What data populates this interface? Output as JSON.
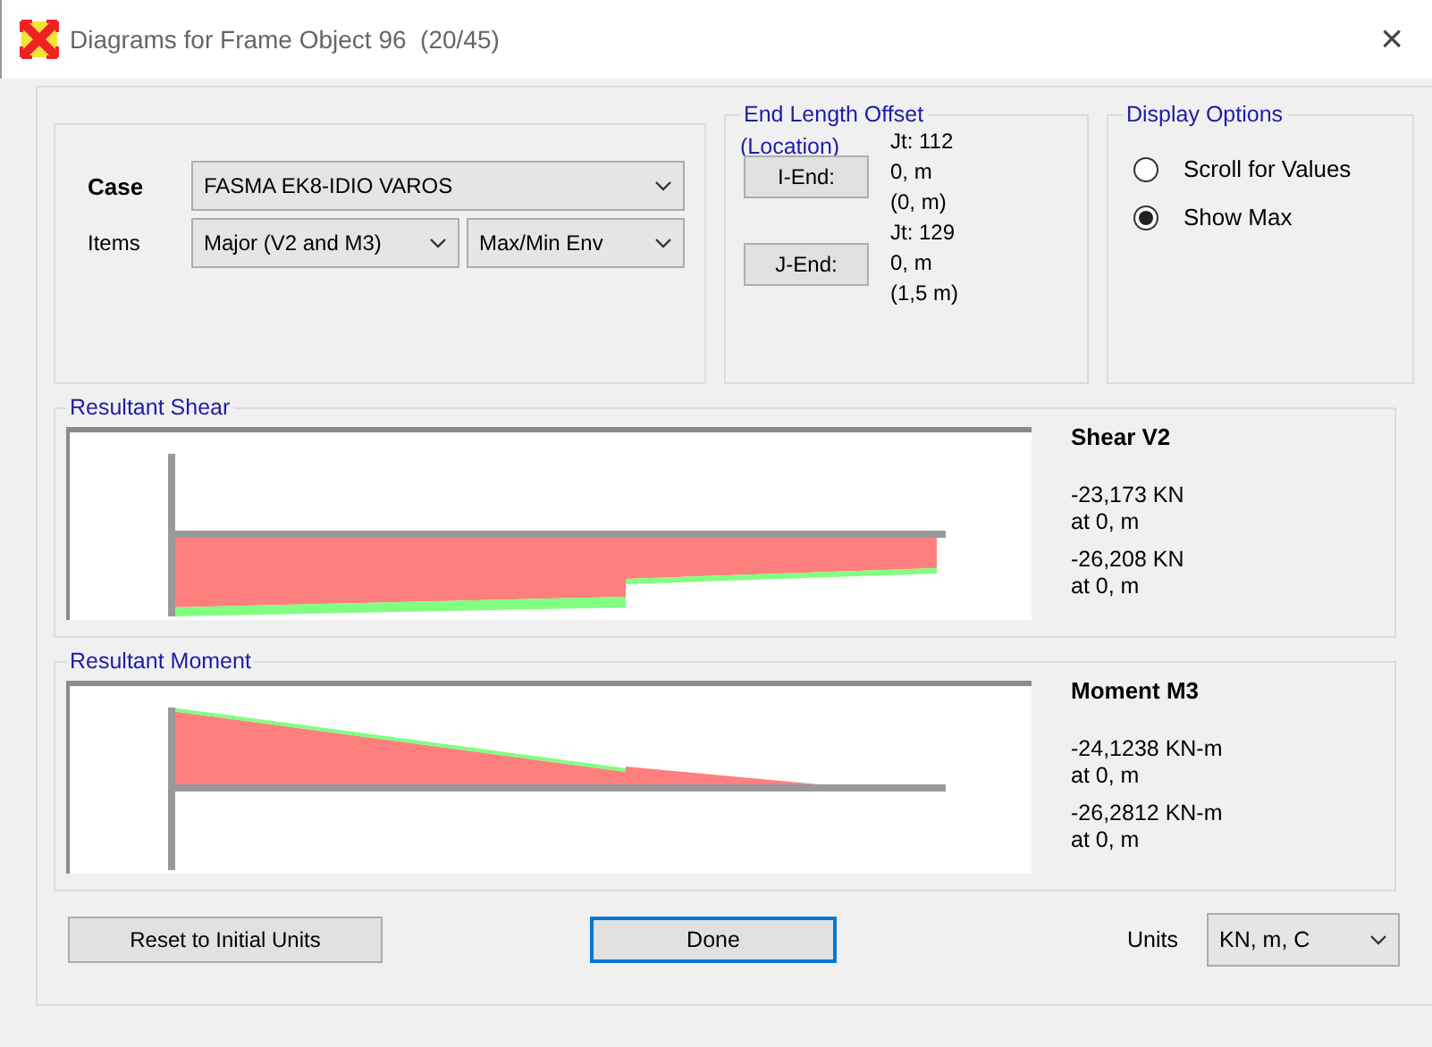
{
  "window": {
    "title": "Diagrams for Frame Object 96  (20/45)",
    "close": "×"
  },
  "case": {
    "label": "Case",
    "value": "FASMA EK8-IDIO VAROS"
  },
  "items": {
    "label": "Items",
    "component": "Major (V2 and M3)",
    "envelope": "Max/Min Env"
  },
  "end_length_offset": {
    "title": "End Length Offset",
    "subtitle": "(Location)",
    "ends": [
      {
        "button": "I-End:",
        "joint": "Jt:  112",
        "offset": "0, m",
        "location": "(0, m)"
      },
      {
        "button": "J-End:",
        "joint": "Jt:  129",
        "offset": "0, m",
        "location": "(1,5 m)"
      }
    ]
  },
  "display_options": {
    "title": "Display Options",
    "options": [
      {
        "label": "Scroll for Values",
        "selected": false
      },
      {
        "label": "Show Max",
        "selected": true
      }
    ]
  },
  "diagrams": [
    {
      "kind": "shear",
      "title": "Resultant Shear",
      "heading": "Shear V2",
      "values": [
        {
          "value": "-23,173 KN",
          "at": "at 0, m"
        },
        {
          "value": "-26,208 KN",
          "at": "at 0, m"
        }
      ]
    },
    {
      "kind": "moment",
      "title": "Resultant Moment",
      "heading": "Moment M3",
      "values": [
        {
          "value": "-24,1238 KN-m",
          "at": "at 0, m"
        },
        {
          "value": "-26,2812 KN-m",
          "at": "at 0, m"
        }
      ]
    }
  ],
  "buttons": {
    "reset": "Reset to Initial Units",
    "done": "Done"
  },
  "units": {
    "label": "Units",
    "value": "KN, m, C"
  }
}
